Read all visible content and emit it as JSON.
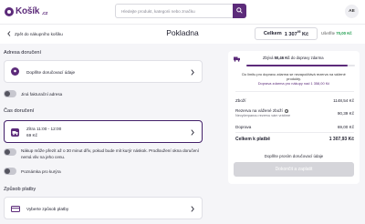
{
  "header": {
    "logo": "Košík",
    "logo_suffix": ".cz",
    "search_placeholder": "Hledejte produkt, kategorii nebo značku",
    "user_initials": "AE"
  },
  "subbar": {
    "back_label": "Zpět do nákupního košíku",
    "title": "Pokladna",
    "total_label": "Celkem",
    "total_value_main": "1 307",
    "total_value_sup": "95",
    "total_currency": "Kč",
    "saved_label": "Ušetříte",
    "saved_value": "70,00 Kč"
  },
  "address": {
    "section_title": "Adresa doručení",
    "card_label": "Doplňte doručovací údaje",
    "billing_toggle": "Jiná fakturační adresa"
  },
  "delivery_time": {
    "section_title": "Čas doručení",
    "slot_label": "Zítra 11:00 - 12:00",
    "slot_price": "69 Kč",
    "early_toggle": "Nákup může přezít až o 30 minut dřív, pokud bude mít kurýr náskok. Prodloužení okna doručení nemá vliv na jeho cenu.",
    "courier_note_toggle": "Poznámka pro kurýra"
  },
  "payment": {
    "section_title": "Způsob platby",
    "card_label": "Vyberte způsob platby"
  },
  "summary": {
    "free_delivery_prefix": "Zbývá",
    "free_delivery_amount": "50,46 Kč",
    "free_delivery_suffix": "do dopravy zdarma",
    "free_delivery_progress": 0.93,
    "promo_line1": "Do limitu pro dopravu zdarma se nezapočítává rezerva na vážené",
    "promo_line1b": "produkty.",
    "promo_line2": "Doprava zdarma pro nákupy nad 1 358,00 Kč",
    "rows": [
      {
        "label": "Zboží",
        "value": "1148,54 Kč"
      },
      {
        "label": "Rezerva na vážené zboží",
        "sub": "Nevyčerpanou rezervu vám vrátíme",
        "value": "90,39 Kč"
      },
      {
        "label": "Doprava",
        "value": "69,00 Kč"
      },
      {
        "label": "Celkem k platbě",
        "value": "1 307,93 Kč"
      }
    ],
    "hint": "Doplňte prosím doručovací údaje",
    "submit_label": "Dokončit a zaplatit"
  }
}
